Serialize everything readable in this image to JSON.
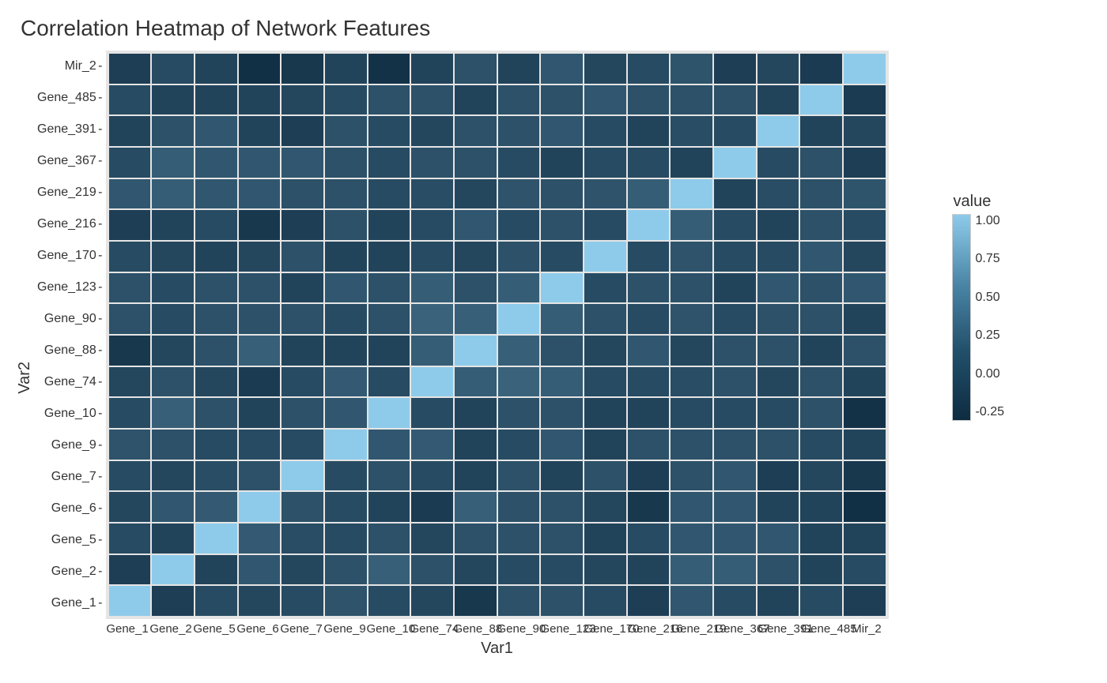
{
  "chart_data": {
    "type": "heatmap",
    "title": "Correlation Heatmap of Network Features",
    "xlabel": "Var1",
    "ylabel": "Var2",
    "x_categories": [
      "Gene_1",
      "Gene_2",
      "Gene_5",
      "Gene_6",
      "Gene_7",
      "Gene_9",
      "Gene_10",
      "Gene_74",
      "Gene_88",
      "Gene_90",
      "Gene_123",
      "Gene_170",
      "Gene_216",
      "Gene_219",
      "Gene_367",
      "Gene_391",
      "Gene_485",
      "Mir_2"
    ],
    "y_categories": [
      "Mir_2",
      "Gene_485",
      "Gene_391",
      "Gene_367",
      "Gene_219",
      "Gene_216",
      "Gene_170",
      "Gene_123",
      "Gene_90",
      "Gene_88",
      "Gene_74",
      "Gene_10",
      "Gene_9",
      "Gene_7",
      "Gene_6",
      "Gene_5",
      "Gene_2",
      "Gene_1"
    ],
    "legend_title": "value",
    "legend_ticks": [
      "1.00",
      "0.75",
      "0.50",
      "0.25",
      "0.00",
      "-0.25"
    ],
    "color_low": "#0e2c41",
    "color_high": "#8ecbea",
    "value_range": [
      -0.3,
      1.0
    ],
    "values": [
      [
        -0.15,
        -0.05,
        -0.1,
        -0.27,
        -0.2,
        -0.1,
        -0.25,
        -0.1,
        0.0,
        -0.1,
        0.05,
        -0.08,
        -0.05,
        0.03,
        -0.15,
        -0.08,
        -0.18,
        1.0
      ],
      [
        -0.05,
        -0.1,
        -0.1,
        -0.1,
        -0.08,
        -0.05,
        0.0,
        0.0,
        -0.1,
        0.0,
        0.0,
        0.05,
        0.0,
        0.0,
        0.0,
        -0.1,
        1.0,
        -0.18
      ],
      [
        -0.1,
        0.0,
        0.05,
        -0.1,
        -0.15,
        0.0,
        -0.05,
        -0.08,
        0.0,
        0.0,
        0.05,
        -0.05,
        -0.1,
        -0.03,
        -0.05,
        1.0,
        -0.1,
        -0.08
      ],
      [
        -0.05,
        0.1,
        0.05,
        0.05,
        0.05,
        0.0,
        -0.05,
        0.0,
        0.0,
        -0.05,
        -0.1,
        -0.05,
        -0.05,
        -0.1,
        1.0,
        -0.05,
        0.0,
        -0.15
      ],
      [
        0.05,
        0.1,
        0.05,
        0.05,
        0.0,
        0.0,
        -0.05,
        -0.03,
        -0.08,
        0.02,
        0.0,
        0.02,
        0.1,
        1.0,
        -0.1,
        -0.03,
        0.0,
        0.03
      ],
      [
        -0.15,
        -0.1,
        -0.05,
        -0.2,
        -0.15,
        0.0,
        -0.1,
        -0.05,
        0.05,
        -0.05,
        0.0,
        -0.05,
        1.0,
        0.1,
        -0.05,
        -0.1,
        0.0,
        -0.05
      ],
      [
        -0.05,
        -0.08,
        -0.1,
        -0.08,
        0.0,
        -0.1,
        -0.1,
        -0.05,
        -0.08,
        0.0,
        -0.05,
        1.0,
        -0.05,
        0.02,
        -0.05,
        -0.05,
        0.05,
        -0.08
      ],
      [
        0.0,
        -0.05,
        0.0,
        0.0,
        -0.1,
        0.05,
        0.0,
        0.1,
        0.0,
        0.1,
        1.0,
        -0.05,
        0.0,
        0.0,
        -0.1,
        0.05,
        0.0,
        0.05
      ],
      [
        0.0,
        -0.05,
        0.0,
        0.0,
        0.0,
        -0.05,
        0.0,
        0.15,
        0.12,
        1.0,
        0.1,
        0.0,
        -0.05,
        0.02,
        -0.05,
        0.0,
        0.0,
        -0.1
      ],
      [
        -0.2,
        -0.08,
        0.0,
        0.12,
        -0.1,
        -0.1,
        -0.1,
        0.1,
        1.0,
        0.12,
        0.0,
        -0.08,
        0.05,
        -0.08,
        0.0,
        0.0,
        -0.1,
        0.0
      ],
      [
        -0.08,
        0.0,
        -0.08,
        -0.18,
        -0.05,
        0.08,
        -0.05,
        1.0,
        0.1,
        0.15,
        0.1,
        -0.05,
        -0.05,
        -0.03,
        0.0,
        -0.08,
        0.0,
        -0.1
      ],
      [
        -0.05,
        0.12,
        0.0,
        -0.1,
        0.0,
        0.05,
        1.0,
        -0.05,
        -0.1,
        0.0,
        0.0,
        -0.1,
        -0.1,
        -0.05,
        -0.05,
        -0.05,
        0.0,
        -0.25
      ],
      [
        0.02,
        0.0,
        -0.05,
        -0.05,
        -0.05,
        1.0,
        0.05,
        0.08,
        -0.1,
        -0.05,
        0.05,
        -0.1,
        0.0,
        0.0,
        0.0,
        0.0,
        -0.05,
        -0.1
      ],
      [
        -0.05,
        -0.08,
        -0.03,
        0.0,
        1.0,
        -0.05,
        0.0,
        -0.05,
        -0.1,
        0.0,
        -0.1,
        0.0,
        -0.15,
        0.0,
        0.05,
        -0.15,
        -0.08,
        -0.2
      ],
      [
        -0.08,
        0.05,
        0.08,
        1.0,
        0.0,
        -0.05,
        -0.1,
        -0.18,
        0.12,
        0.0,
        0.0,
        -0.08,
        -0.2,
        0.05,
        0.05,
        -0.1,
        -0.1,
        -0.27
      ],
      [
        -0.05,
        -0.1,
        1.0,
        0.08,
        -0.03,
        -0.05,
        0.0,
        -0.08,
        0.0,
        0.0,
        0.0,
        -0.1,
        -0.05,
        0.05,
        0.05,
        0.05,
        -0.1,
        -0.1
      ],
      [
        -0.15,
        1.0,
        -0.1,
        0.05,
        -0.08,
        0.0,
        0.12,
        0.0,
        -0.08,
        -0.05,
        -0.05,
        -0.08,
        -0.1,
        0.1,
        0.1,
        0.0,
        -0.1,
        -0.05
      ],
      [
        1.0,
        -0.15,
        -0.05,
        -0.08,
        -0.05,
        0.02,
        -0.05,
        -0.08,
        -0.2,
        0.0,
        0.0,
        -0.05,
        -0.15,
        0.05,
        -0.05,
        -0.1,
        -0.05,
        -0.15
      ]
    ]
  }
}
